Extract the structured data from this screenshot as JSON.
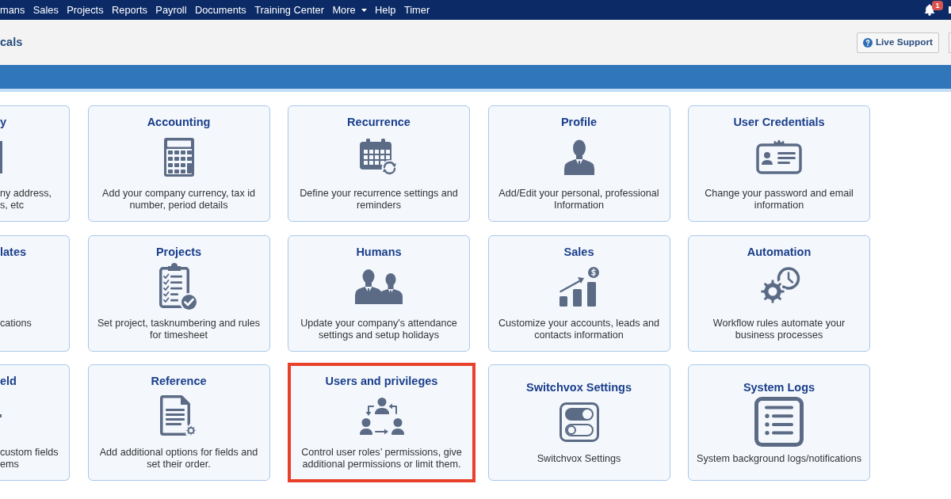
{
  "top_nav": {
    "links": [
      {
        "label": "mans",
        "dropdown": false
      },
      {
        "label": "Sales",
        "dropdown": false
      },
      {
        "label": "Projects",
        "dropdown": false
      },
      {
        "label": "Reports",
        "dropdown": false
      },
      {
        "label": "Payroll",
        "dropdown": false
      },
      {
        "label": "Documents",
        "dropdown": false
      },
      {
        "label": "Training Center",
        "dropdown": false
      },
      {
        "label": "More",
        "dropdown": true
      },
      {
        "label": "Help",
        "dropdown": false
      },
      {
        "label": "Timer",
        "dropdown": false
      }
    ],
    "notification_count": "1"
  },
  "header": {
    "title": "cals",
    "live_support_button": "Live Support"
  },
  "card_rows": [
    {
      "cut_card": {
        "title": "y",
        "description_lines": [
          "ny address,",
          "s, etc"
        ]
      },
      "cards": [
        {
          "title": "Accounting",
          "description": "Add your company currency, tax id number, period details",
          "highlighted": false
        },
        {
          "title": "Recurrence",
          "description": "Define your recurrence settings and reminders",
          "highlighted": false
        },
        {
          "title": "Profile",
          "description": "Add/Edit your personal, professional Information",
          "highlighted": false
        },
        {
          "title": "User Credentials",
          "description": "Change your password and email information",
          "highlighted": false
        }
      ]
    },
    {
      "cut_card": {
        "title": "lates",
        "description_lines": [
          "cations"
        ]
      },
      "cards": [
        {
          "title": "Projects",
          "description": "Set project, tasknumbering and rules for timesheet",
          "highlighted": false
        },
        {
          "title": "Humans",
          "description": "Update your company's attendance settings and setup holidays",
          "highlighted": false
        },
        {
          "title": "Sales",
          "description": "Customize your accounts, leads and contacts information",
          "highlighted": false
        },
        {
          "title": "Automation",
          "description": "Workflow rules automate your business processes",
          "highlighted": false
        }
      ]
    },
    {
      "cut_card": {
        "title": "eld",
        "description_lines": [
          "custom fields",
          "ems"
        ]
      },
      "cards": [
        {
          "title": "Reference",
          "description": "Add additional options for fields and set their order.",
          "highlighted": false
        },
        {
          "title": "Users and privileges",
          "description": "Control user roles’ permissions, give additional permissions or limit them.",
          "highlighted": true
        },
        {
          "title": "Switchvox Settings",
          "description": "Switchvox Settings",
          "highlighted": false
        },
        {
          "title": "System Logs",
          "description": "System background logs/notifications",
          "highlighted": false
        }
      ]
    }
  ]
}
